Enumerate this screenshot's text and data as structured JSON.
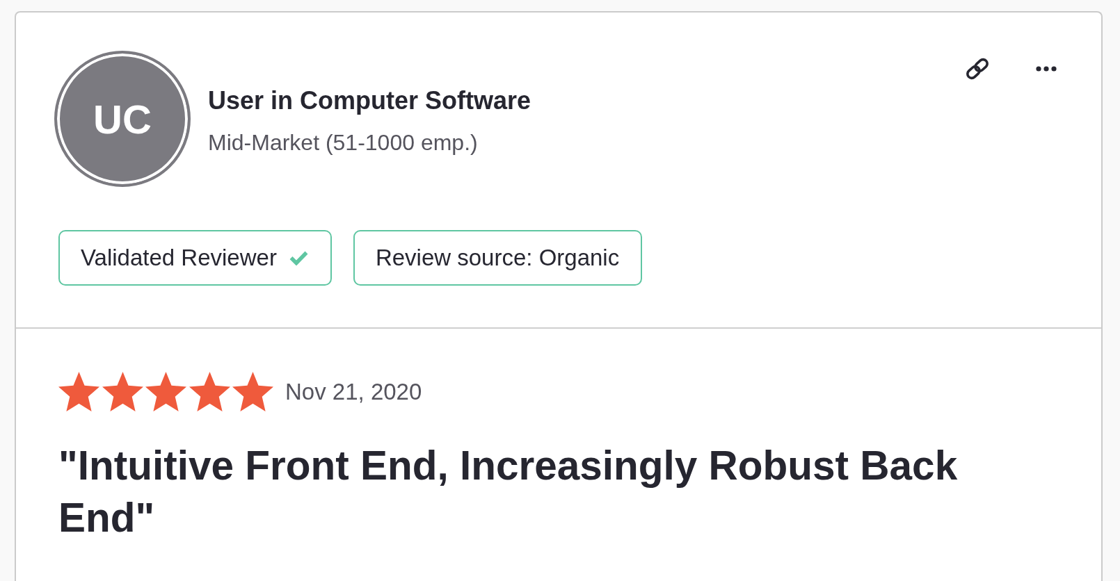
{
  "reviewer": {
    "initials": "UC",
    "title": "User in Computer Software",
    "segment": "Mid-Market (51-1000 emp.)"
  },
  "badges": [
    {
      "label": "Validated Reviewer",
      "verified": true
    },
    {
      "label": "Review source: Organic",
      "verified": false
    }
  ],
  "review": {
    "stars": 5,
    "date": "Nov 21, 2020",
    "title": "\"Intuitive Front End, Increasingly Robust Back End\""
  }
}
